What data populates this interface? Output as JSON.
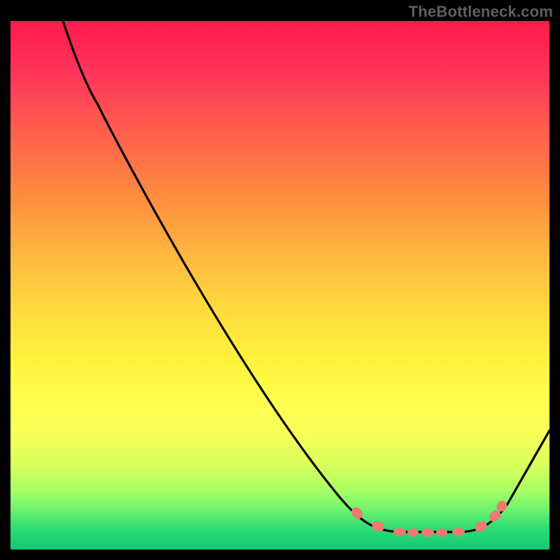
{
  "watermark": "TheBottleneck.com",
  "colors": {
    "frame_bg": "#000000",
    "watermark_text": "#5f5f5f",
    "curve": "#000000",
    "markers": "#ee7a73",
    "gradient_top": "#ff1a4d",
    "gradient_mid": "#fff23c",
    "gradient_bottom": "#14c878"
  },
  "chart_data": {
    "type": "line",
    "title": "",
    "xlabel": "",
    "ylabel": "",
    "xlim": [
      0,
      100
    ],
    "ylim": [
      0,
      100
    ],
    "grid": false,
    "legend": null,
    "series": [
      {
        "name": "bottleneck-curve",
        "x": [
          10,
          14,
          17,
          25,
          40,
          55,
          61,
          66,
          72,
          75,
          78,
          82,
          84,
          87,
          90,
          92,
          100
        ],
        "y": [
          100,
          90,
          84,
          70,
          42,
          18,
          10,
          5,
          3.3,
          3.3,
          3.3,
          3.3,
          3.3,
          4.5,
          7,
          9,
          23
        ]
      }
    ],
    "markers": {
      "name": "trough-points",
      "x": [
        64,
        68,
        72,
        75,
        77,
        80,
        83,
        87,
        90,
        91
      ],
      "y": [
        7.0,
        4.5,
        3.3,
        3.2,
        3.2,
        3.2,
        3.3,
        4.5,
        6.5,
        8.0
      ],
      "color": "#ee7a73",
      "shape": "ellipse"
    },
    "annotations": [
      {
        "text": "TheBottleneck.com",
        "position": "top-right"
      }
    ]
  }
}
